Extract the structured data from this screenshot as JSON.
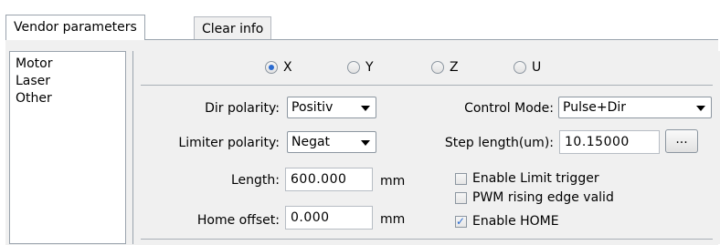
{
  "tabs": [
    {
      "label": "Vendor parameters",
      "active": true
    },
    {
      "label": "Clear info",
      "active": false
    }
  ],
  "sidebar": {
    "items": [
      {
        "label": "Motor"
      },
      {
        "label": "Laser"
      },
      {
        "label": "Other"
      }
    ]
  },
  "axis_selector": {
    "options": [
      "X",
      "Y",
      "Z",
      "U"
    ],
    "selected": "X"
  },
  "params": {
    "dir_polarity_label": "Dir polarity:",
    "dir_polarity_value": "Positiv",
    "limiter_polarity_label": "Limiter polarity:",
    "limiter_polarity_value": "Negat",
    "control_mode_label": "Control Mode:",
    "control_mode_value": "Pulse+Dir",
    "step_length_label": "Step length(um):",
    "step_length_value": "10.15000",
    "browse_label": "...",
    "length_label": "Length:",
    "length_value": "600.000",
    "length_unit": "mm",
    "home_offset_label": "Home offset:",
    "home_offset_value": "0.000",
    "home_offset_unit": "mm"
  },
  "checkboxes": [
    {
      "label": "Enable Limit trigger",
      "checked": false
    },
    {
      "label": "PWM rising edge valid",
      "checked": false
    },
    {
      "label": "Enable HOME",
      "checked": true
    }
  ]
}
